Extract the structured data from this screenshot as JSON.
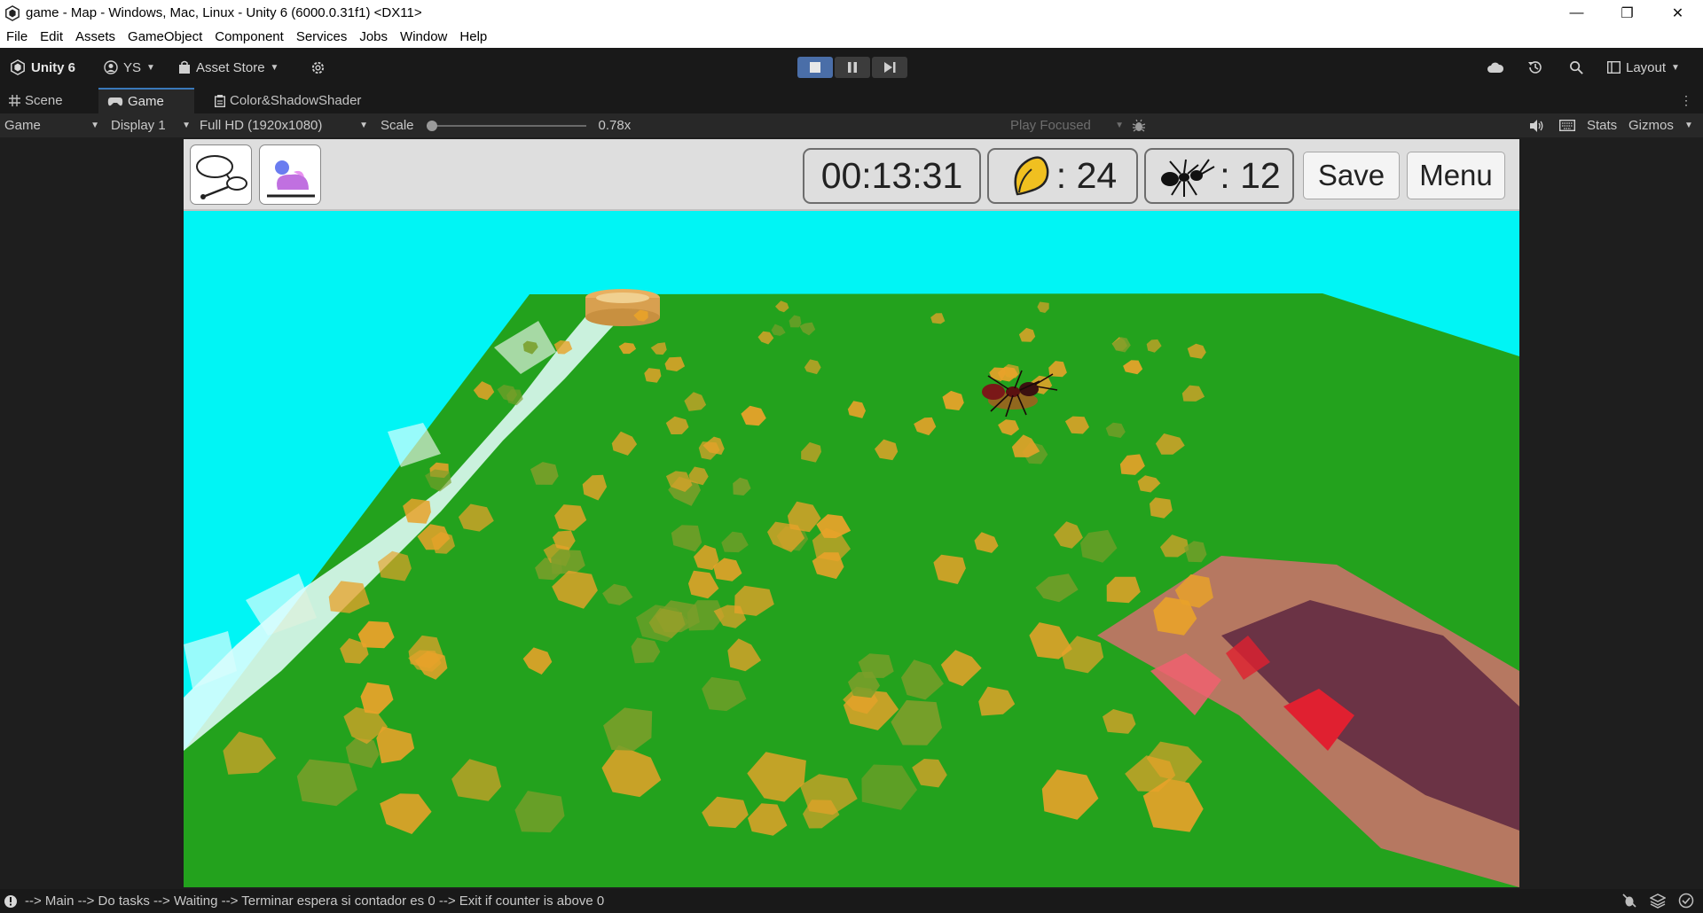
{
  "window": {
    "title": "game - Map - Windows, Mac, Linux - Unity 6 (6000.0.31f1) <DX11>",
    "minimize": "—",
    "restore": "❐",
    "close": "✕"
  },
  "menu": [
    "File",
    "Edit",
    "Assets",
    "GameObject",
    "Component",
    "Services",
    "Jobs",
    "Window",
    "Help"
  ],
  "toolbar": {
    "account": "Unity 6",
    "user": "YS",
    "asset_store": "Asset Store",
    "layout": "Layout"
  },
  "tabs": [
    "Scene",
    "Game",
    "Color&ShadowShader"
  ],
  "gamebar": {
    "view": "Game",
    "display": "Display 1",
    "resolution": "Full HD (1920x1080)",
    "scale_label": "Scale",
    "scale_value": "0.78x",
    "play_mode": "Play Focused",
    "stats": "Stats",
    "gizmos": "Gizmos"
  },
  "hud": {
    "timer": "00:13:31",
    "seeds_count": ": 24",
    "ants_count": ": 12",
    "save": "Save",
    "menu": "Menu"
  },
  "status": {
    "message": "--> Main --> Do tasks --> Waiting --> Terminar espera si contador es 0 --> Exit if counter is above 0"
  },
  "colors": {
    "sky": "#00f5f5",
    "ground": "#23a21d",
    "seed": "#e8a22a",
    "nest": "#e86a78",
    "play_active": "#4a6ea8"
  }
}
